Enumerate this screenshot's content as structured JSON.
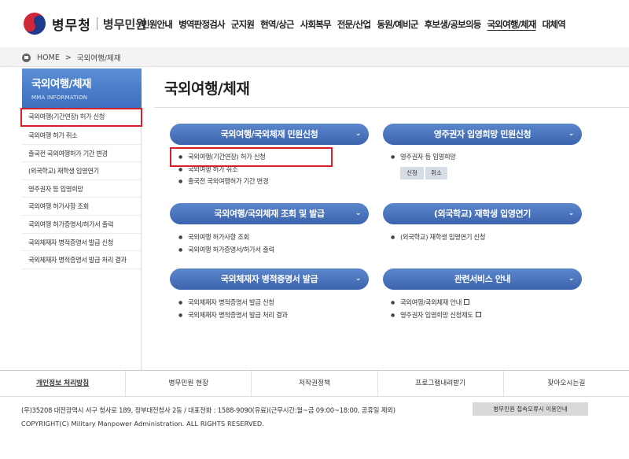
{
  "header": {
    "logo_text": "병무청",
    "logo_sub": "병무민원",
    "nav": [
      {
        "label": "민원안내"
      },
      {
        "label": "병역판정검사"
      },
      {
        "label": "군지원"
      },
      {
        "label": "현역/상근"
      },
      {
        "label": "사회복무"
      },
      {
        "label": "전문/산업"
      },
      {
        "label": "동원/예비군"
      },
      {
        "label": "후보생/공보의등"
      },
      {
        "label": "국외여행/체재"
      },
      {
        "label": "대체역"
      }
    ]
  },
  "breadcrumb": {
    "home": "HOME",
    "separator": ">",
    "current": "국외여행/체재"
  },
  "sidebar": {
    "title": "국외여행/체재",
    "subtitle": "MMA INFORMATION",
    "items": [
      {
        "label": "국외여행(기간연장) 허가 신청"
      },
      {
        "label": "국외여행 허가 취소"
      },
      {
        "label": "출국전 국외여행허가 기간 변경"
      },
      {
        "label": "(외국학교) 재학생 입영연기"
      },
      {
        "label": "영주권자 등 입영희망"
      },
      {
        "label": "국외여행 허가사항 조회"
      },
      {
        "label": "국외여행 허가증명서/허가서 출력"
      },
      {
        "label": "국외체재자 병적증명서 발급 신청"
      },
      {
        "label": "국외체재자 병적증명서 발급 처리 결과"
      }
    ]
  },
  "main": {
    "title": "국외여행/체재",
    "panels": [
      {
        "label": "국외여행/국외체재 민원신청",
        "items": [
          "국외여행(기간연장) 허가 신청",
          "국외여행 허가 취소",
          "출국전 국외여행허가 기간 변경"
        ]
      },
      {
        "label": "영주권자 입영희망 민원신청",
        "items": [
          "영주권자 등 입영희망"
        ],
        "buttons": [
          "신청",
          "취소"
        ]
      },
      {
        "label": "국외여행/국외체재 조회 및 발급",
        "items": [
          "국외여행 허가사항 조회",
          "국외여행 허가증명서/허가서 출력"
        ]
      },
      {
        "label": "(외국학교) 재학생 입영연기",
        "items": [
          "(외국학교) 재학생 입영연기 신청"
        ]
      },
      {
        "label": "국외체재자 병적증명서 발급",
        "items": [
          "국외체재자 병적증명서 발급 신청",
          "국외체재자 병적증명서 발급 처리 결과"
        ]
      },
      {
        "label": "관련서비스 안내",
        "items": [
          "국외여행/국외체재 안내",
          "영주권자 입영희망 신청제도"
        ]
      }
    ],
    "chevron": "⌄"
  },
  "footer": {
    "links": [
      "개인정보 처리방침",
      "병무민원 현장",
      "저작권정책",
      "프로그램내려받기",
      "찾아오시는길"
    ],
    "address": "(우)35208 대전광역시 서구 청사로 189, 정부대전청사 2동 / 대표전화 : 1588-9090(유료)(근무시간:월~금 09:00~18:00, 공휴일 제외)",
    "copyright": "COPYRIGHT(C) Military Manpower Administration. ALL RIGHTS RESERVED.",
    "error_guide": "병무민원 접속오류시 이용안내"
  },
  "colors": {
    "accent": "#3b63ad",
    "highlight": "#d32029"
  }
}
